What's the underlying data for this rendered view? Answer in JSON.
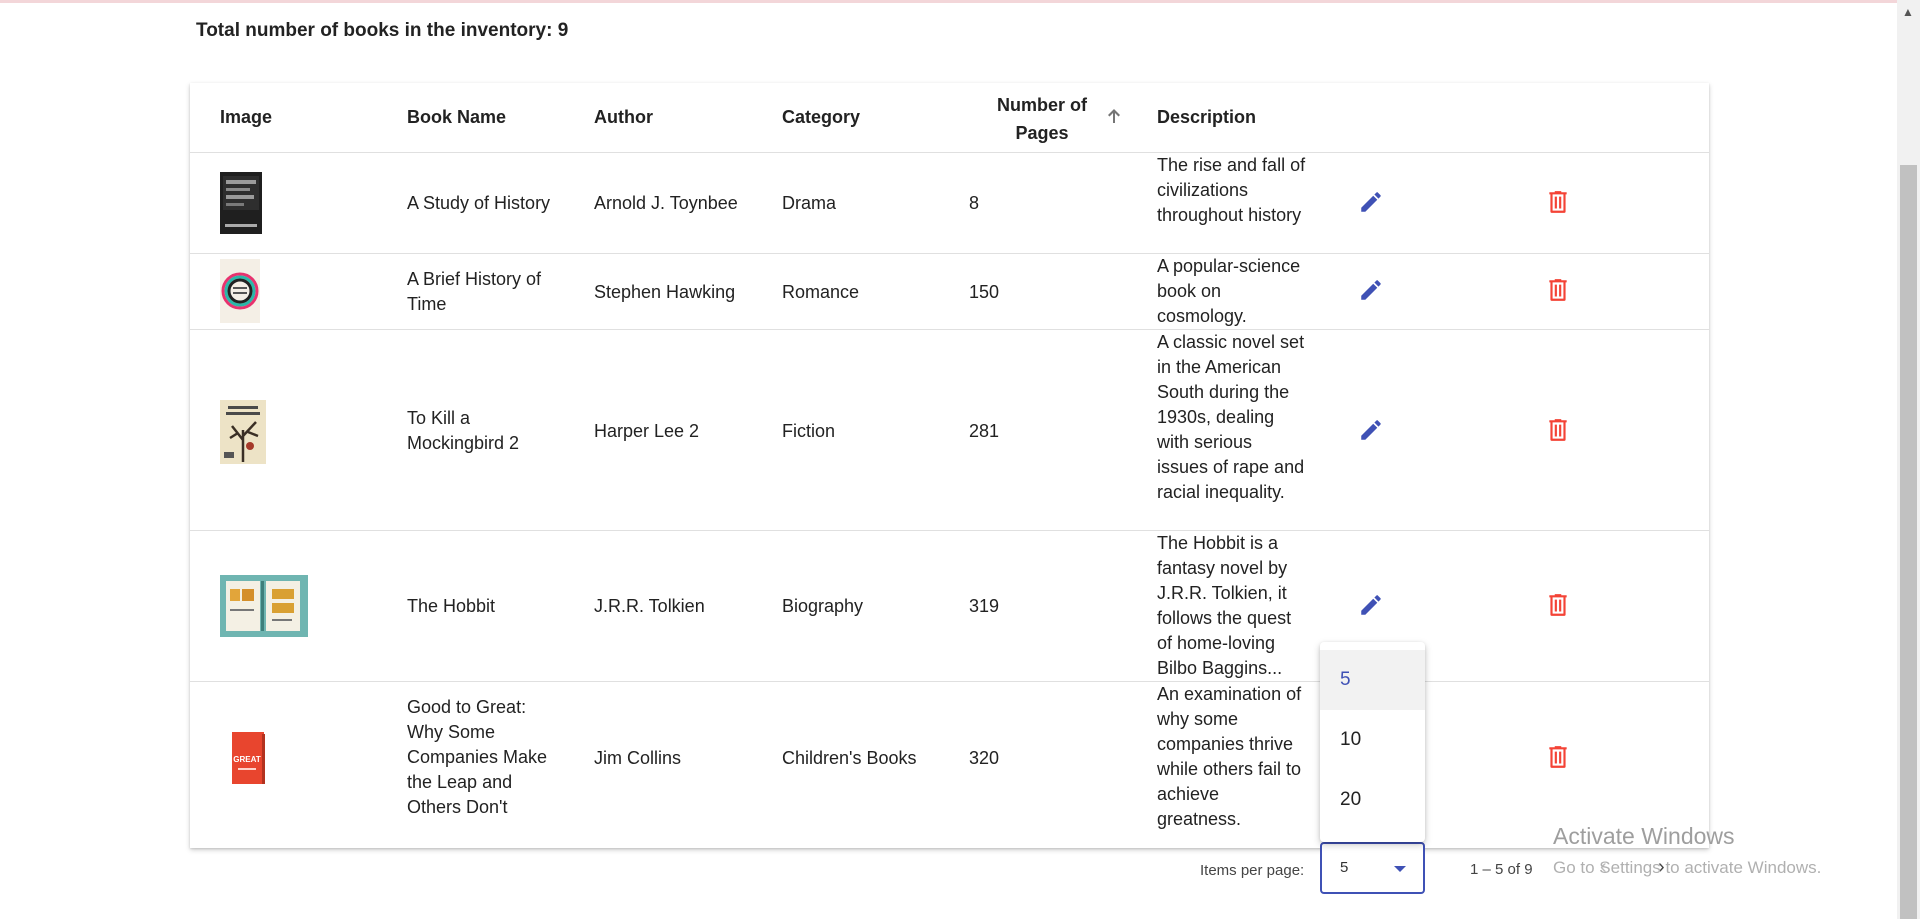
{
  "summary": {
    "total_text": "Total number of books in the inventory: 9"
  },
  "table": {
    "headers": {
      "image": "Image",
      "book_name": "Book Name",
      "author": "Author",
      "category": "Category",
      "pages_line1": "Number of",
      "pages_line2": "Pages",
      "description": "Description"
    },
    "sort": {
      "column": "Number of Pages",
      "direction": "ascending",
      "icon": "arrow-up-icon"
    },
    "rows": [
      {
        "book_name": "A Study of History",
        "author": "Arnold J. Toynbee",
        "category": "Drama",
        "pages": "8",
        "description": "The rise and fall of civilizations throughout history",
        "cover_icon": "book-cover-dark-icon"
      },
      {
        "book_name": "A Brief History of Time",
        "author": "Stephen Hawking",
        "category": "Romance",
        "pages": "150",
        "description": "A popular-science book on cosmology.",
        "cover_icon": "book-cover-rainbow-icon"
      },
      {
        "book_name": "To Kill a Mockingbird 2",
        "author": "Harper Lee 2",
        "category": "Fiction",
        "pages": "281",
        "description": "A classic novel set in the American South during the 1930s, dealing with serious issues of rape and racial inequality.",
        "cover_icon": "book-cover-tree-icon"
      },
      {
        "book_name": "The Hobbit",
        "author": "J.R.R. Tolkien",
        "category": "Biography",
        "pages": "319",
        "description": "The Hobbit is a fantasy novel by J.R.R. Tolkien, it follows the quest of home-loving Bilbo Baggins...",
        "cover_icon": "book-cover-teal-icon"
      },
      {
        "book_name": "Good to Great: Why Some Companies Make the Leap and Others Don't",
        "author": "Jim Collins",
        "category": "Children's Books",
        "pages": "320",
        "description": "An examination of why some companies thrive while others fail to achieve greatness.",
        "cover_icon": "book-cover-red-icon",
        "cover_text": "GREAT"
      }
    ],
    "actions": {
      "edit_icon": "pencil-icon",
      "delete_icon": "trash-icon",
      "edit_color": "#3f51b5",
      "delete_color": "#f44336"
    }
  },
  "paginator": {
    "items_per_page_label": "Items per page:",
    "selected_page_size": "5",
    "options": [
      "5",
      "10",
      "20"
    ],
    "range_label": "1 – 5 of 9"
  },
  "watermark": {
    "title": "Activate Windows",
    "subtitle": "Go to Settings to activate Windows."
  },
  "colors": {
    "accent": "#3f51b5",
    "danger": "#f44336"
  }
}
